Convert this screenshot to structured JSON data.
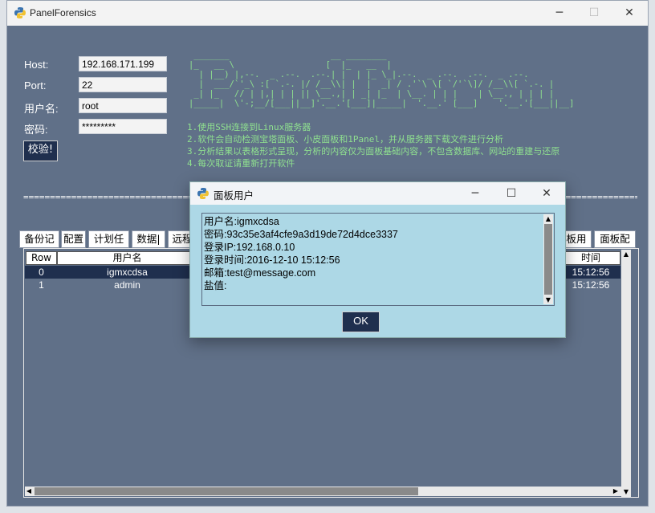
{
  "window": {
    "title": "PanelForensics"
  },
  "form": {
    "host_label": "Host:",
    "host_value": "192.168.171.199",
    "port_label": "Port:",
    "port_value": "22",
    "user_label": "用户名:",
    "user_value": "root",
    "pass_label": "密码:",
    "pass_value": "*********",
    "verify_button": "校验!"
  },
  "info_lines": [
    "1.使用SSH连接到Linux服务器",
    "2.软件会自动检测宝塔面板、小皮面板和1Panel，并从服务器下载文件进行分析",
    "3.分析结果以表格形式呈现，分析的内容仅为面板基础内容，不包含数据库、网站的重建与还原",
    "4.每次取证请重新打开软件"
  ],
  "tabs": [
    "备份记",
    "配置",
    "计划任",
    "数据|",
    "远程",
    "板用",
    "面板配"
  ],
  "table": {
    "headers": [
      "Row",
      "用户名",
      "时间"
    ],
    "rows": [
      {
        "row": "0",
        "user": "igmxcdsa",
        "time": "15:12:56",
        "selected": true
      },
      {
        "row": "1",
        "user": "admin",
        "time": "15:12:56",
        "selected": false
      }
    ]
  },
  "dialog": {
    "title": "面板用户",
    "lines": [
      "用户名:igmxcdsa",
      "密码:93c35e3af4cfe9a3d19de72d4dce3337",
      "登录IP:192.168.0.10",
      "登录时间:2016-12-10 15:12:56",
      "邮箱:test@message.com",
      "盐值:"
    ],
    "ok_label": "OK"
  },
  "colors": {
    "window_bg": "#607088",
    "accent_dark": "#1f2f4e",
    "dialog_bg": "#add8e6",
    "console_green": "#8fe08f"
  },
  "icons": [
    "python-icon",
    "minimize-icon",
    "maximize-icon",
    "close-icon"
  ]
}
